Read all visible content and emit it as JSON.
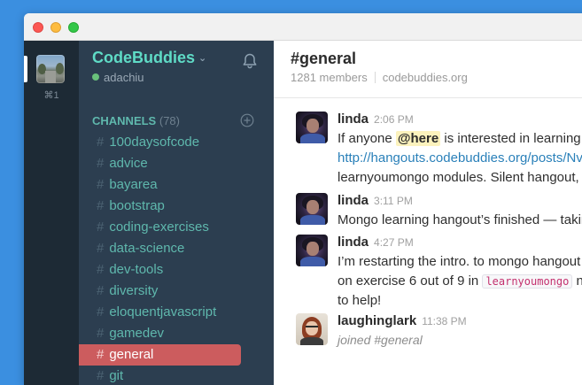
{
  "team_rail": {
    "shortcut": "⌘1"
  },
  "sidebar": {
    "team_name": "CodeBuddies",
    "username": "adachiu",
    "channels_label": "CHANNELS",
    "channels_count": "(78)",
    "channels": [
      {
        "name": "100daysofcode",
        "active": false
      },
      {
        "name": "advice",
        "active": false
      },
      {
        "name": "bayarea",
        "active": false
      },
      {
        "name": "bootstrap",
        "active": false
      },
      {
        "name": "coding-exercises",
        "active": false
      },
      {
        "name": "data-science",
        "active": false
      },
      {
        "name": "dev-tools",
        "active": false
      },
      {
        "name": "diversity",
        "active": false
      },
      {
        "name": "eloquentjavascript",
        "active": false
      },
      {
        "name": "gamedev",
        "active": false
      },
      {
        "name": "general",
        "active": true
      },
      {
        "name": "git",
        "active": false
      }
    ]
  },
  "header": {
    "title": "#general",
    "members": "1281 members",
    "topic": "codebuddies.org"
  },
  "messages": [
    {
      "author": "linda",
      "time": "2:06 PM",
      "line1_pre": "If anyone ",
      "mention": "@here",
      "line1_post": " is interested in learning m",
      "line2_link": "http://hangouts.codebuddies.org/posts/Nv",
      "line3": "learnyoumongo modules. Silent hangout, so"
    },
    {
      "author": "linda",
      "time": "3:11 PM",
      "line1": "Mongo learning hangout’s finished — takin"
    },
    {
      "author": "linda",
      "time": "4:27 PM",
      "line1": "I’m restarting the intro. to mongo hangout a",
      "line2_pre": "on exercise 6 out of 9 in ",
      "line2_code": "learnyoumongo",
      "line2_post": " no",
      "line3": "to help!"
    },
    {
      "author": "laughinglark",
      "time": "11:38 PM",
      "line1": "joined #general"
    }
  ],
  "colors": {
    "sidebar_bg": "#2c3e50",
    "team_rail_bg": "#1d2a35",
    "accent_teal": "#5fdbc6",
    "active_channel": "#cc5c5e",
    "link": "#2a80b9"
  }
}
